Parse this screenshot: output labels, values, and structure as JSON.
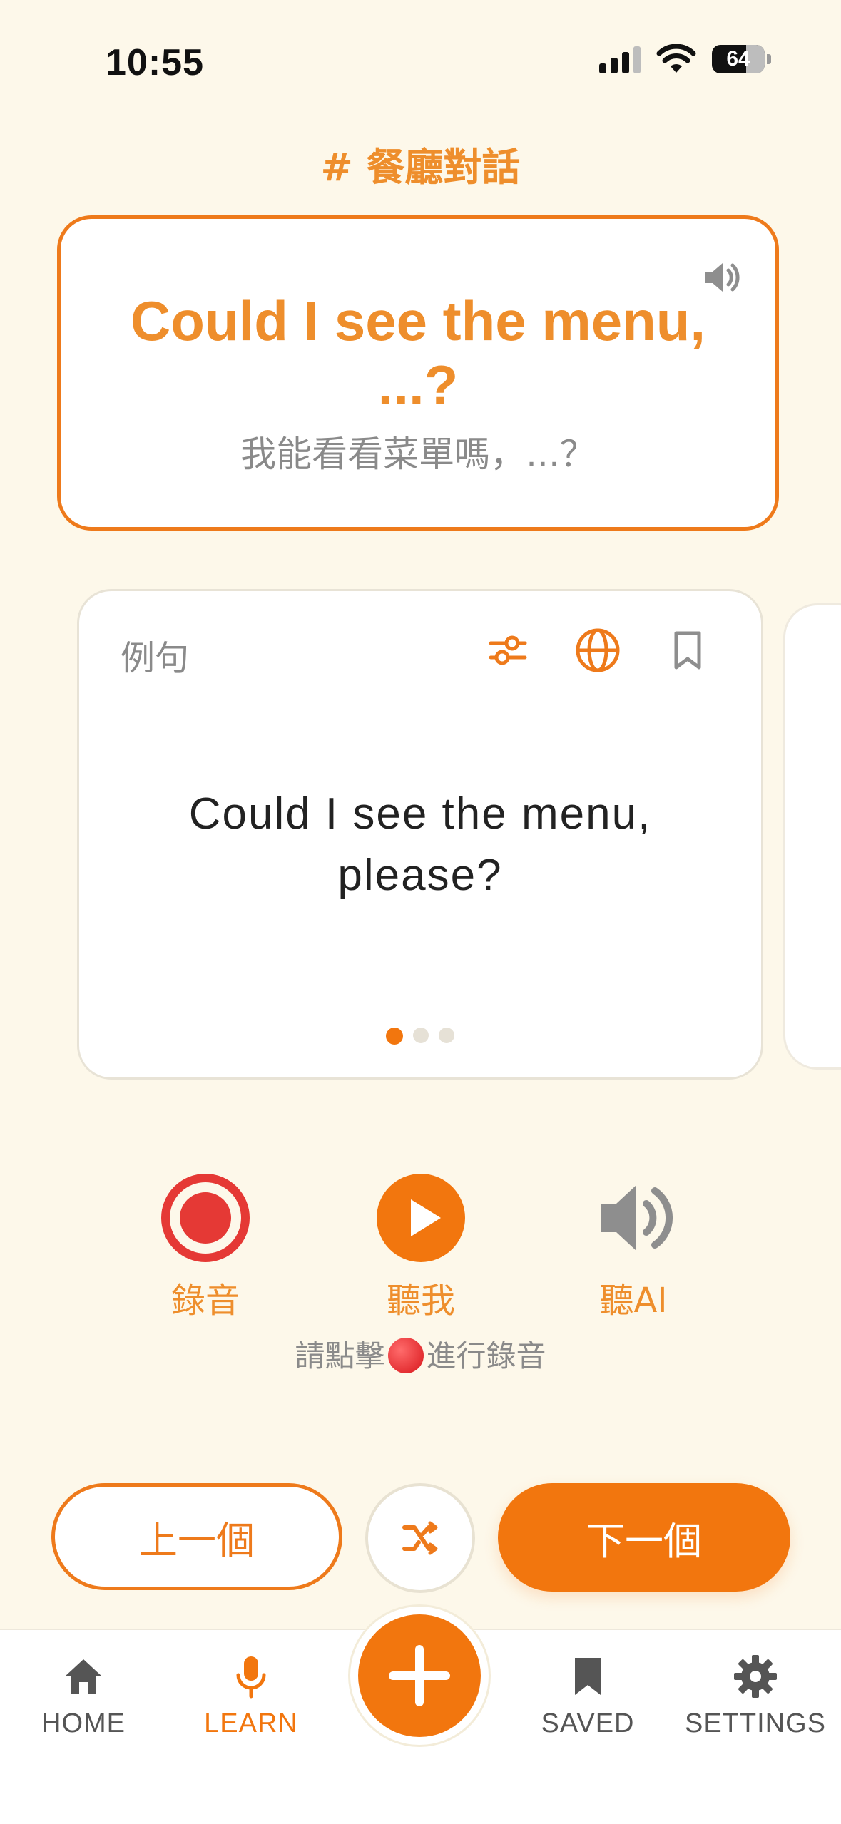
{
  "status_bar": {
    "time": "10:55",
    "battery": "64"
  },
  "topic": "# 餐廳對話",
  "phrase": {
    "english": "Could I see the menu, ...?",
    "chinese": "我能看看菜單嗎，...？",
    "icon": "speaker-icon"
  },
  "example": {
    "label": "例句",
    "sentence": "Could I see the menu, please?",
    "tools": [
      "sliders-icon",
      "globe-icon",
      "bookmark-icon"
    ],
    "page_index": 1,
    "page_count": 3
  },
  "actions": {
    "record_label": "錄音",
    "listen_me_label": "聽我",
    "listen_ai_label": "聽AI"
  },
  "hint": {
    "before": "請點擊",
    "after": "進行錄音"
  },
  "navigation": {
    "prev_label": "上一個",
    "next_label": "下一個",
    "shuffle_icon": "shuffle-icon"
  },
  "tabbar": {
    "home": "HOME",
    "learn": "LEARN",
    "saved": "SAVED",
    "settings": "SETTINGS",
    "active": "learn"
  },
  "colors": {
    "accent": "#F2760E",
    "accent_text": "#EE8E2C",
    "background": "#FDF8EA",
    "record_red": "#E53935",
    "muted_gray": "#8A8A8A"
  }
}
